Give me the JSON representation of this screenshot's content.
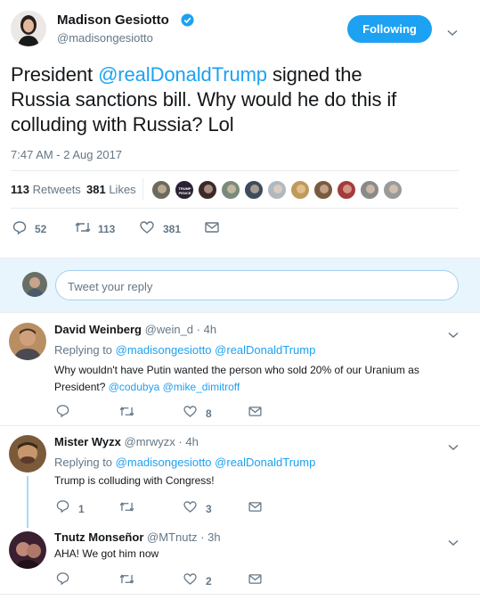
{
  "tweet": {
    "author_name": "Madison Gesiotto",
    "author_handle": "@madisongesiotto",
    "follow_button_label": "Following",
    "text_before_mention": "President ",
    "mention": "@realDonaldTrump",
    "text_line1_after": " signed the",
    "text_line2": "Russia sanctions bill. Why would he do this if",
    "text_line3": "colluding with Russia? Lol",
    "timestamp": "7:47 AM - 2 Aug 2017",
    "retweets_count": "113",
    "retweets_label": "Retweets",
    "likes_count": "381",
    "likes_label": "Likes",
    "actions": {
      "replies": "52",
      "retweets": "113",
      "likes": "381"
    },
    "liker_avatar_colors": [
      "#6b6a5c",
      "#2a2233",
      "#3a2a2a",
      "#7b8a7a",
      "#3c4c5c",
      "#b0b8c0",
      "#c09a5a",
      "#7a5a40",
      "#a43c3c",
      "#8a8a8a",
      "#9a9a9a"
    ],
    "liker_avatar_label": "TRUMP PENCE"
  },
  "reply_box": {
    "placeholder": "Tweet your reply"
  },
  "replies": [
    {
      "name": "David Weinberg",
      "handle": "@wein_d",
      "time": "· 4h",
      "replying_to_label": "Replying to",
      "replying_to_1": "@madisongesiotto",
      "replying_to_2": "@realDonaldTrump",
      "text_line1": "Why wouldn't have Putin wanted the person who sold 20% of our Uranium as",
      "text_line2_prefix": "President? ",
      "text_mention_1": "@codubya",
      "text_mention_2": "@mike_dimitroff",
      "reply_count": "",
      "retweet_count": "",
      "like_count": "8"
    },
    {
      "name": "Mister Wyzx",
      "handle": "@mrwyzx",
      "time": "· 4h",
      "replying_to_label": "Replying to",
      "replying_to_1": "@madisongesiotto",
      "replying_to_2": "@realDonaldTrump",
      "text": "Trump is colluding with Congress!",
      "reply_count": "1",
      "retweet_count": "",
      "like_count": "3"
    },
    {
      "name": "Tnutz Monseñor",
      "handle": "@MTnutz",
      "time": "· 3h",
      "text": "AHA! We got him now",
      "reply_count": "",
      "retweet_count": "",
      "like_count": "2"
    }
  ],
  "colors": {
    "accent": "#1da1f2",
    "muted": "#657786",
    "border": "#e6ecf0"
  }
}
